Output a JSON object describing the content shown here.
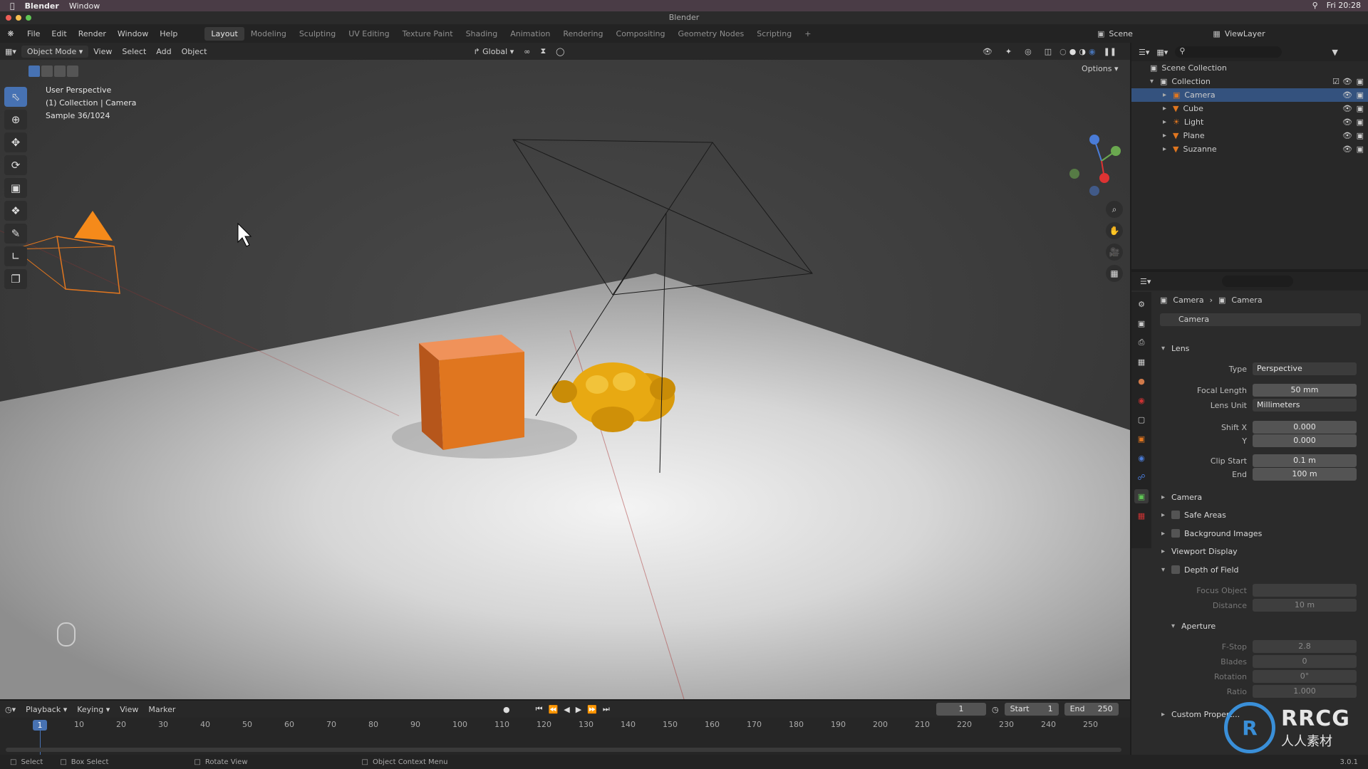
{
  "mac": {
    "app": "Blender",
    "window": "Window",
    "clock": "Fri 20:28"
  },
  "window_title": "Blender",
  "menus": [
    "File",
    "Edit",
    "Render",
    "Window",
    "Help"
  ],
  "workspaces": [
    "Layout",
    "Modeling",
    "Sculpting",
    "UV Editing",
    "Texture Paint",
    "Shading",
    "Animation",
    "Rendering",
    "Compositing",
    "Geometry Nodes",
    "Scripting"
  ],
  "workspace_add": "+",
  "scene": {
    "label": "Scene",
    "view_layer": "ViewLayer"
  },
  "viewport_header": {
    "mode": "Object Mode",
    "view": "View",
    "select": "Select",
    "add": "Add",
    "object": "Object",
    "orientation": "Global",
    "options": "Options"
  },
  "viewport_info": {
    "line1": "User Perspective",
    "line2": "(1) Collection | Camera",
    "line3": "Sample 36/1024"
  },
  "outliner": {
    "root": "Scene Collection",
    "collection": "Collection",
    "items": [
      {
        "name": "Camera",
        "selected": true
      },
      {
        "name": "Cube",
        "selected": false
      },
      {
        "name": "Light",
        "selected": false
      },
      {
        "name": "Plane",
        "selected": false
      },
      {
        "name": "Suzanne",
        "selected": false
      }
    ]
  },
  "properties": {
    "breadcrumb": [
      "Camera",
      "Camera"
    ],
    "datablock": "Camera",
    "lens_section": "Lens",
    "type_label": "Type",
    "type_value": "Perspective",
    "focal_label": "Focal Length",
    "focal_value": "50 mm",
    "lens_unit_label": "Lens Unit",
    "lens_unit_value": "Millimeters",
    "shift_x_label": "Shift X",
    "shift_x_value": "0.000",
    "shift_y_label": "Y",
    "shift_y_value": "0.000",
    "clip_start_label": "Clip Start",
    "clip_start_value": "0.1 m",
    "clip_end_label": "End",
    "clip_end_value": "100 m",
    "camera_section": "Camera",
    "safe_areas": "Safe Areas",
    "background_images": "Background Images",
    "viewport_display": "Viewport Display",
    "dof": "Depth of Field",
    "focus_object_label": "Focus Object",
    "distance_label": "Distance",
    "distance_value": "10 m",
    "aperture": "Aperture",
    "fstop_label": "F-Stop",
    "fstop_value": "2.8",
    "blades_label": "Blades",
    "blades_value": "0",
    "rotation_label": "Rotation",
    "rotation_value": "0°",
    "ratio_label": "Ratio",
    "ratio_value": "1.000",
    "custom_props": "Custom Propert..."
  },
  "timeline": {
    "playback": "Playback",
    "keying": "Keying",
    "view": "View",
    "marker": "Marker",
    "current": "1",
    "start_label": "Start",
    "start": "1",
    "end_label": "End",
    "end": "250",
    "ticks": [
      "10",
      "20",
      "30",
      "40",
      "50",
      "60",
      "70",
      "80",
      "90",
      "100",
      "110",
      "120",
      "130",
      "140",
      "150",
      "160",
      "170",
      "180",
      "190",
      "200",
      "210",
      "220",
      "230",
      "240",
      "250"
    ]
  },
  "status": {
    "select": "Select",
    "box_select": "Box Select",
    "rotate_view": "Rotate View",
    "context_menu": "Object Context Menu",
    "version": "3.0.1"
  },
  "watermark": {
    "brand": "RRCG",
    "sub": "人人素材"
  },
  "colors": {
    "accent": "#4772b3",
    "orange_cube": "#e0761f",
    "suzanne": "#e8a912"
  }
}
